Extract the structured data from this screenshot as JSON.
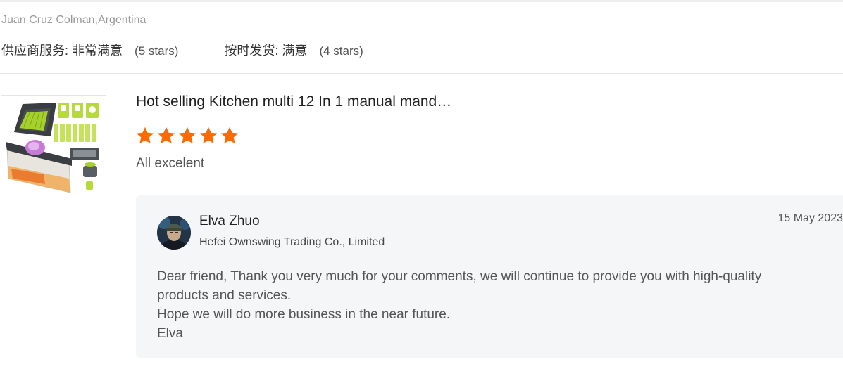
{
  "review": {
    "buyer": "Juan Cruz Colman,Argentina",
    "ratings": [
      {
        "label": "供应商服务:",
        "value": "非常满意",
        "stars": "(5 stars)"
      },
      {
        "label": "按时发货:",
        "value": "满意",
        "stars": "(4 stars)"
      }
    ],
    "product": {
      "title": "Hot selling Kitchen multi 12 In 1 manual mand…",
      "image_icon": "vegetable-chopper-product-image",
      "rating": 5,
      "max_rating": 5,
      "star_color": "#ff6a00"
    },
    "comment": "All excelent"
  },
  "reply": {
    "name": "Elva Zhuo",
    "company": "Hefei Ownswing Trading Co., Limited",
    "date": "15 May 2023",
    "lines": [
      "Dear friend, Thank you very much for your comments, we will continue to provide you with high-quality",
      "products and services.",
      "Hope we will do more business in the near future.",
      "Elva"
    ]
  }
}
